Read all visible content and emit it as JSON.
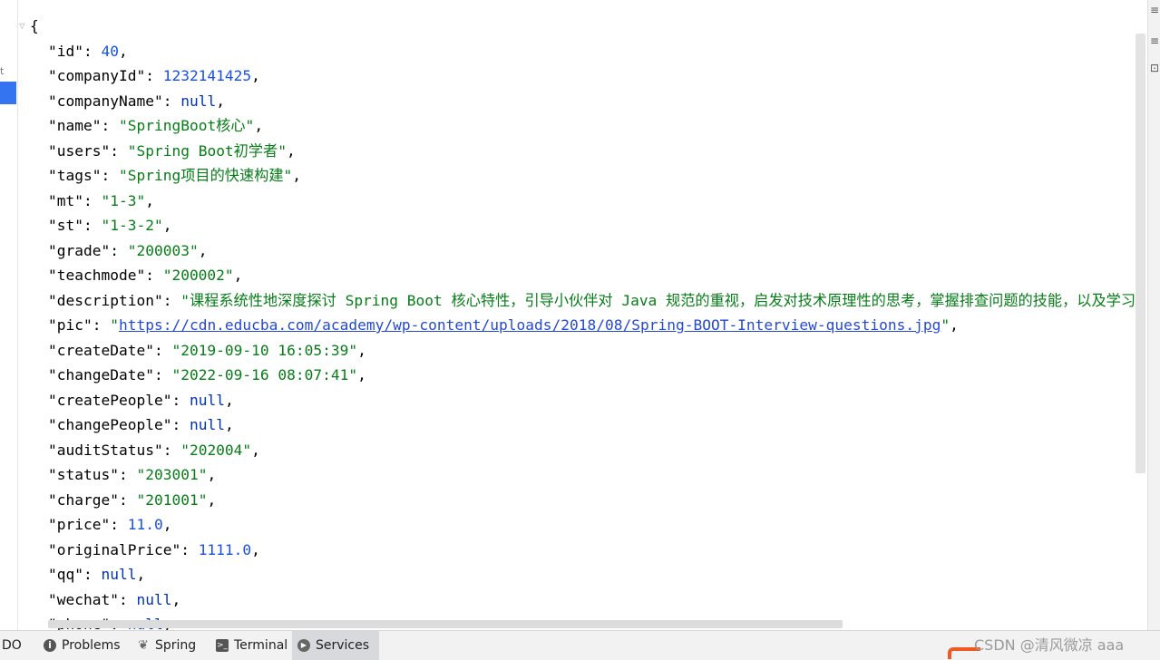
{
  "json_lines": [
    {
      "parts": [
        {
          "t": "{",
          "c": "pun"
        }
      ]
    },
    {
      "indent": true,
      "parts": [
        {
          "t": "\"id\"",
          "c": "key"
        },
        {
          "t": ": ",
          "c": "pun"
        },
        {
          "t": "40",
          "c": "num"
        },
        {
          "t": ",",
          "c": "pun"
        }
      ]
    },
    {
      "indent": true,
      "parts": [
        {
          "t": "\"companyId\"",
          "c": "key"
        },
        {
          "t": ": ",
          "c": "pun"
        },
        {
          "t": "1232141425",
          "c": "num"
        },
        {
          "t": ",",
          "c": "pun"
        }
      ]
    },
    {
      "indent": true,
      "parts": [
        {
          "t": "\"companyName\"",
          "c": "key"
        },
        {
          "t": ": ",
          "c": "pun"
        },
        {
          "t": "null",
          "c": "nul"
        },
        {
          "t": ",",
          "c": "pun"
        }
      ]
    },
    {
      "indent": true,
      "parts": [
        {
          "t": "\"name\"",
          "c": "key"
        },
        {
          "t": ": ",
          "c": "pun"
        },
        {
          "t": "\"SpringBoot核心\"",
          "c": "str"
        },
        {
          "t": ",",
          "c": "pun"
        }
      ]
    },
    {
      "indent": true,
      "parts": [
        {
          "t": "\"users\"",
          "c": "key"
        },
        {
          "t": ": ",
          "c": "pun"
        },
        {
          "t": "\"Spring Boot初学者\"",
          "c": "str"
        },
        {
          "t": ",",
          "c": "pun"
        }
      ]
    },
    {
      "indent": true,
      "parts": [
        {
          "t": "\"tags\"",
          "c": "key"
        },
        {
          "t": ": ",
          "c": "pun"
        },
        {
          "t": "\"Spring项目的快速构建\"",
          "c": "str"
        },
        {
          "t": ",",
          "c": "pun"
        }
      ]
    },
    {
      "indent": true,
      "parts": [
        {
          "t": "\"mt\"",
          "c": "key"
        },
        {
          "t": ": ",
          "c": "pun"
        },
        {
          "t": "\"1-3\"",
          "c": "str"
        },
        {
          "t": ",",
          "c": "pun"
        }
      ]
    },
    {
      "indent": true,
      "parts": [
        {
          "t": "\"st\"",
          "c": "key"
        },
        {
          "t": ": ",
          "c": "pun"
        },
        {
          "t": "\"1-3-2\"",
          "c": "str"
        },
        {
          "t": ",",
          "c": "pun"
        }
      ]
    },
    {
      "indent": true,
      "parts": [
        {
          "t": "\"grade\"",
          "c": "key"
        },
        {
          "t": ": ",
          "c": "pun"
        },
        {
          "t": "\"200003\"",
          "c": "str"
        },
        {
          "t": ",",
          "c": "pun"
        }
      ]
    },
    {
      "indent": true,
      "parts": [
        {
          "t": "\"teachmode\"",
          "c": "key"
        },
        {
          "t": ": ",
          "c": "pun"
        },
        {
          "t": "\"200002\"",
          "c": "str"
        },
        {
          "t": ",",
          "c": "pun"
        }
      ]
    },
    {
      "indent": true,
      "parts": [
        {
          "t": "\"description\"",
          "c": "key"
        },
        {
          "t": ": ",
          "c": "pun"
        },
        {
          "t": "\"课程系统性地深度探讨 Spring Boot 核心特性，引导小伙伴对 Java 规范的重视，启发对技术原理性的思考，掌握排查问题的技能，以及学习阅",
          "c": "str"
        }
      ]
    },
    {
      "indent": true,
      "parts": [
        {
          "t": "\"pic\"",
          "c": "key"
        },
        {
          "t": ": ",
          "c": "pun"
        },
        {
          "t": "\"",
          "c": "str"
        },
        {
          "t": "https://cdn.educba.com/academy/wp-content/uploads/2018/08/Spring-BOOT-Interview-questions.jpg",
          "c": "link"
        },
        {
          "t": "\"",
          "c": "str"
        },
        {
          "t": ",",
          "c": "pun"
        }
      ]
    },
    {
      "indent": true,
      "parts": [
        {
          "t": "\"createDate\"",
          "c": "key"
        },
        {
          "t": ": ",
          "c": "pun"
        },
        {
          "t": "\"2019-09-10 16:05:39\"",
          "c": "str"
        },
        {
          "t": ",",
          "c": "pun"
        }
      ]
    },
    {
      "indent": true,
      "parts": [
        {
          "t": "\"changeDate\"",
          "c": "key"
        },
        {
          "t": ": ",
          "c": "pun"
        },
        {
          "t": "\"2022-09-16 08:07:41\"",
          "c": "str"
        },
        {
          "t": ",",
          "c": "pun"
        }
      ]
    },
    {
      "indent": true,
      "parts": [
        {
          "t": "\"createPeople\"",
          "c": "key"
        },
        {
          "t": ": ",
          "c": "pun"
        },
        {
          "t": "null",
          "c": "nul"
        },
        {
          "t": ",",
          "c": "pun"
        }
      ]
    },
    {
      "indent": true,
      "parts": [
        {
          "t": "\"changePeople\"",
          "c": "key"
        },
        {
          "t": ": ",
          "c": "pun"
        },
        {
          "t": "null",
          "c": "nul"
        },
        {
          "t": ",",
          "c": "pun"
        }
      ]
    },
    {
      "indent": true,
      "parts": [
        {
          "t": "\"auditStatus\"",
          "c": "key"
        },
        {
          "t": ": ",
          "c": "pun"
        },
        {
          "t": "\"202004\"",
          "c": "str"
        },
        {
          "t": ",",
          "c": "pun"
        }
      ]
    },
    {
      "indent": true,
      "parts": [
        {
          "t": "\"status\"",
          "c": "key"
        },
        {
          "t": ": ",
          "c": "pun"
        },
        {
          "t": "\"203001\"",
          "c": "str"
        },
        {
          "t": ",",
          "c": "pun"
        }
      ]
    },
    {
      "indent": true,
      "parts": [
        {
          "t": "\"charge\"",
          "c": "key"
        },
        {
          "t": ": ",
          "c": "pun"
        },
        {
          "t": "\"201001\"",
          "c": "str"
        },
        {
          "t": ",",
          "c": "pun"
        }
      ]
    },
    {
      "indent": true,
      "parts": [
        {
          "t": "\"price\"",
          "c": "key"
        },
        {
          "t": ": ",
          "c": "pun"
        },
        {
          "t": "11.0",
          "c": "num"
        },
        {
          "t": ",",
          "c": "pun"
        }
      ]
    },
    {
      "indent": true,
      "parts": [
        {
          "t": "\"originalPrice\"",
          "c": "key"
        },
        {
          "t": ": ",
          "c": "pun"
        },
        {
          "t": "1111.0",
          "c": "num"
        },
        {
          "t": ",",
          "c": "pun"
        }
      ]
    },
    {
      "indent": true,
      "parts": [
        {
          "t": "\"qq\"",
          "c": "key"
        },
        {
          "t": ": ",
          "c": "pun"
        },
        {
          "t": "null",
          "c": "nul"
        },
        {
          "t": ",",
          "c": "pun"
        }
      ]
    },
    {
      "indent": true,
      "parts": [
        {
          "t": "\"wechat\"",
          "c": "key"
        },
        {
          "t": ": ",
          "c": "pun"
        },
        {
          "t": "null",
          "c": "nul"
        },
        {
          "t": ",",
          "c": "pun"
        }
      ]
    },
    {
      "indent": true,
      "parts": [
        {
          "t": "\"phone\"",
          "c": "key"
        },
        {
          "t": ": ",
          "c": "pun"
        },
        {
          "t": "null",
          "c": "nul"
        },
        {
          "t": ",",
          "c": "pun"
        }
      ]
    }
  ],
  "bottom_tabs": {
    "todo": "DO",
    "problems": "Problems",
    "spring": "Spring",
    "terminal": "Terminal",
    "services": "Services"
  },
  "left_strip": {
    "tick": "t"
  },
  "right_strip": {
    "a": "≡",
    "b": "≡",
    "c": "⊡"
  },
  "watermark": "CSDN @清风微凉 aaa",
  "colors": {
    "string": "#067d17",
    "number": "#1750eb",
    "keyword": "#0033b3",
    "link": "#2649d3",
    "accent": "#3574f0"
  }
}
